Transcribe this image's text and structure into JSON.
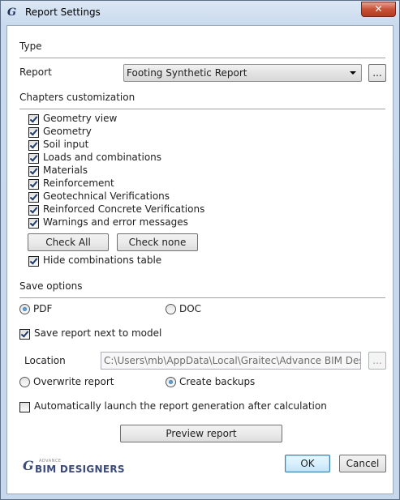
{
  "window": {
    "title": "Report Settings",
    "close_label": "✕"
  },
  "type_section": {
    "heading": "Type",
    "report_label": "Report",
    "report_value": "Footing Synthetic Report",
    "browse_label": "..."
  },
  "chapters": {
    "heading": "Chapters customization",
    "items": [
      {
        "label": "Geometry view",
        "checked": true
      },
      {
        "label": "Geometry",
        "checked": true
      },
      {
        "label": "Soil input",
        "checked": true
      },
      {
        "label": "Loads and combinations",
        "checked": true
      },
      {
        "label": "Materials",
        "checked": true
      },
      {
        "label": "Reinforcement",
        "checked": true
      },
      {
        "label": "Geotechnical Verifications",
        "checked": true
      },
      {
        "label": "Reinforced Concrete Verifications",
        "checked": true
      },
      {
        "label": "Warnings and error messages",
        "checked": true
      }
    ],
    "check_all_label": "Check All",
    "check_none_label": "Check none",
    "hide_combinations_label": "Hide combinations table",
    "hide_combinations_checked": true
  },
  "save_options": {
    "heading": "Save options",
    "format_pdf_label": "PDF",
    "format_doc_label": "DOC",
    "selected_format": "PDF",
    "save_next_label": "Save report next to model",
    "save_next_checked": true,
    "location_label": "Location",
    "location_value": "C:\\Users\\mb\\AppData\\Local\\Graitec\\Advance BIM Designer",
    "location_browse_label": "...",
    "overwrite_label": "Overwrite report",
    "backups_label": "Create backups",
    "selected_mode": "Create backups",
    "auto_launch_label": "Automatically launch the report generation after calculation",
    "auto_launch_checked": false
  },
  "footer": {
    "preview_label": "Preview report",
    "logo_top": "ADVANCE",
    "logo_main": "BIM DESIGNERS",
    "logo_mark": "G",
    "ok_label": "OK",
    "cancel_label": "Cancel"
  },
  "colors": {
    "titlebar": "#c9daee",
    "close": "#c75036",
    "default_button_border": "#3c7fb1",
    "logo": "#3a4a7a"
  }
}
